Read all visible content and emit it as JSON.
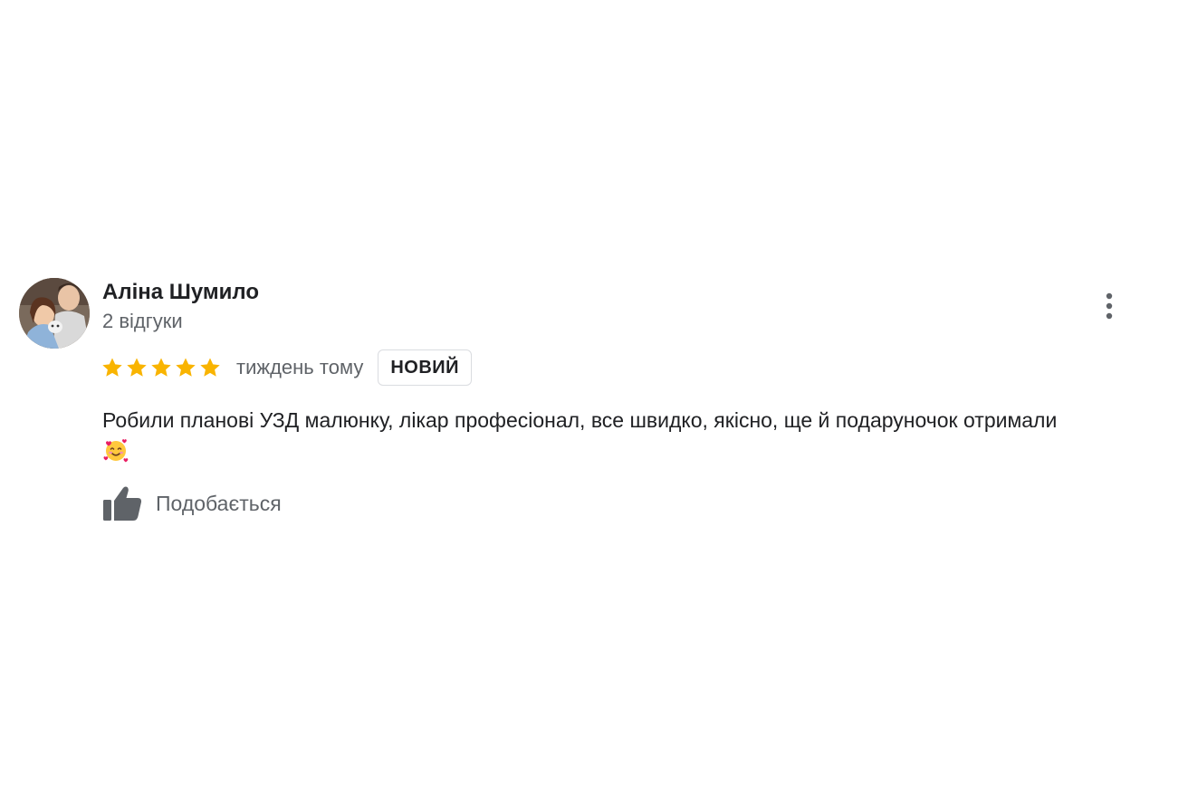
{
  "review": {
    "author_name": "Аліна Шумило",
    "author_meta": "2 відгуки",
    "rating": 5,
    "rating_max": 5,
    "time_ago": "тиждень тому",
    "badge": "НОВИЙ",
    "text": "Робили планові УЗД малюнку, лікар професіонал, все швидко, якісно, ще й подаруночок отримали",
    "text_emoji_icon": "smiling-face-with-hearts-icon",
    "like_label": "Подобається",
    "menu_icon": "more-vertical-icon",
    "like_icon": "thumbs-up-icon"
  },
  "colors": {
    "star": "#f9b400",
    "primary_text": "#202124",
    "secondary_text": "#5f6368",
    "badge_border": "#dadce0",
    "icon": "#5f6368"
  }
}
